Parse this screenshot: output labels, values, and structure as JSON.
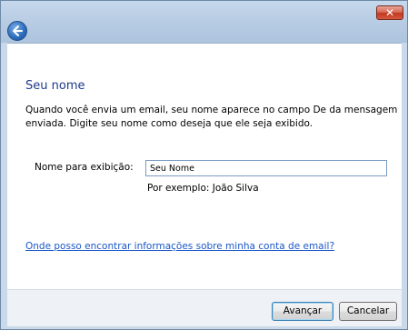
{
  "window": {
    "close_label": "✕"
  },
  "page": {
    "title": "Seu nome",
    "description": "Quando você envia um email, seu nome aparece no campo De da mensagem enviada. Digite seu nome como deseja que ele seja exibido.",
    "display_name_label": "Nome para exibição:",
    "display_name_value": "Seu Nome",
    "example_text": "Por exemplo: João Silva",
    "help_link": "Onde posso encontrar informações sobre minha conta de email?"
  },
  "footer": {
    "next_label": "Avançar",
    "cancel_label": "Cancelar"
  },
  "colors": {
    "title": "#1e3b8a",
    "link": "#1a57c8",
    "close": "#c2371e"
  },
  "icons": {
    "back": "back-arrow-icon",
    "close": "close-icon"
  }
}
